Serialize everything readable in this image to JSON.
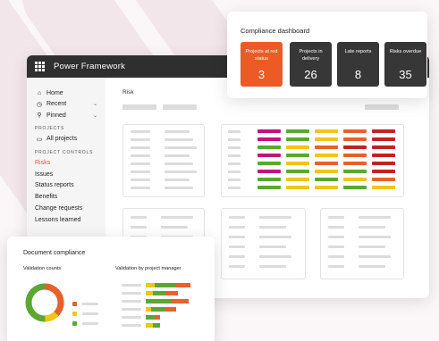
{
  "app": {
    "title": "Power Framework"
  },
  "sidebar": {
    "home": "Home",
    "recent": "Recent",
    "pinned": "Pinned",
    "projects_section": "PROJECTS",
    "all_projects": "All projects",
    "controls_section": "PROJECT CONTROLS",
    "items": [
      "Risks",
      "Issues",
      "Status reports",
      "Benefits",
      "Change requests",
      "Lessons learned"
    ]
  },
  "content": {
    "page_title": "Risk"
  },
  "dashboard": {
    "title": "Compliance dashboard",
    "kpis": [
      {
        "label": "Projects at red status",
        "value": "3"
      },
      {
        "label": "Projects in delivery",
        "value": "26"
      },
      {
        "label": "Late reports",
        "value": "8"
      },
      {
        "label": "Risks overdue",
        "value": "35"
      }
    ]
  },
  "document_compliance": {
    "title": "Document compliance",
    "validation_counts_label": "Validation counts",
    "by_manager_label": "Validation by project manager"
  },
  "colors": {
    "accent": "#ec5a26",
    "red": "#c42027",
    "orange": "#e8602c",
    "yellow": "#f2c417",
    "green": "#5aa832",
    "magenta": "#c4127a",
    "dark": "#2f2f2f"
  }
}
